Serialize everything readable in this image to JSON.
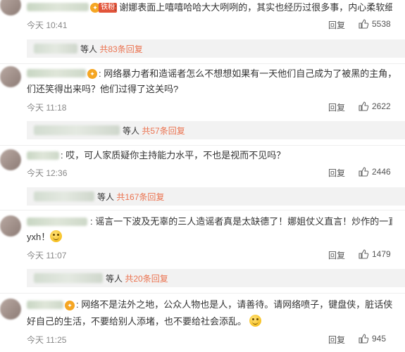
{
  "comments": [
    {
      "badge": "铁粉",
      "text": ": 谢娜表面上嘻嘻哈哈大大咧咧的，其实也经历过很多事，内心柔软细腻",
      "line2": "",
      "time": "今天 10:41",
      "reply": "回复",
      "likes": "5538",
      "sub_prefix": "等人",
      "sub_link": "共83条回复"
    },
    {
      "text": ": 网络暴力者和造谣者怎么不想想如果有一天他们自己成为了被黑的主角，他",
      "line2": "们还笑得出来吗？他们过得了这关吗?",
      "time": "今天 11:18",
      "reply": "回复",
      "likes": "2622",
      "sub_prefix": "等人",
      "sub_link": "共57条回复"
    },
    {
      "text": ": 哎，可人家质疑你主持能力水平，不也是视而不见吗？",
      "line2": "",
      "time": "今天 12:36",
      "reply": "回复",
      "likes": "2446",
      "sub_prefix": "等人",
      "sub_link": "共167条回复"
    },
    {
      "text": ": 谣言一下波及无辜的三人造谣者真是太缺德了！娜姐仗义直言！炒作的一直是",
      "line2": "yxh！",
      "time": "今天 11:07",
      "reply": "回复",
      "likes": "1479",
      "sub_prefix": "等人",
      "sub_link": "共20条回复"
    },
    {
      "text": ": 网络不是法外之地，公众人物也是人，请善待。请网络喷子，键盘侠，脏话侠等管",
      "line2": "好自己的生活，不要给别人添堵，也不要给社会添乱。",
      "time": "今天 11:25",
      "reply": "回复",
      "likes": "945"
    }
  ]
}
